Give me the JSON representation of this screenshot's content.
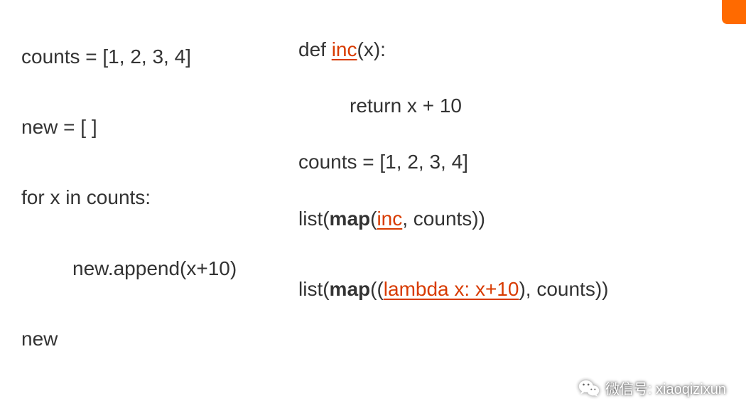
{
  "left": {
    "l1": "counts = [1, 2, 3, 4]",
    "l2": "new = [ ]",
    "l3": "for x in counts:",
    "l4": "new.append(x+10)",
    "l5": "new"
  },
  "right": {
    "r1a": "def ",
    "r1b": "inc",
    "r1c": "(x):",
    "r2": "return x + 10",
    "r3": "counts = [1, 2, 3, 4]",
    "r4a": "list(",
    "r4b": "map",
    "r4c": "(",
    "r4d": "inc",
    "r4e": ", counts))",
    "r5a": "list(",
    "r5b": "map",
    "r5c": "((",
    "r5d": "lambda x: x+10",
    "r5e": "), counts))"
  },
  "watermark": {
    "label": "微信号: xiaoqizixun"
  }
}
